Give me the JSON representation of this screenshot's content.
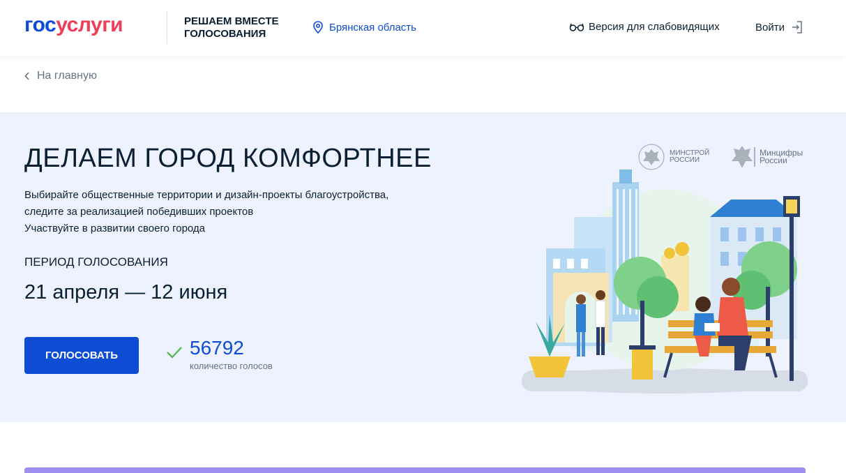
{
  "header": {
    "logo_part1": "гос",
    "logo_part2": "услуги",
    "project_title": "РЕШАЕМ ВМЕСТЕ ГОЛОСОВАНИЯ",
    "region": "Брянская область",
    "accessibility_label": "Версия для слабовидящих",
    "login_label": "Войти"
  },
  "breadcrumb": {
    "back_label": "На главную"
  },
  "hero": {
    "title": "ДЕЛАЕМ ГОРОД КОМФОРТНЕЕ",
    "description_line1": "Выбирайте общественные территории и дизайн-проекты благоустройства,",
    "description_line2": "следите за реализацией победивших проектов",
    "description_line3": "Участвуйте в развитии своего города",
    "period_label": "ПЕРИОД ГОЛОСОВАНИЯ",
    "period_value": "21 апреля — 12 июня",
    "vote_button": "ГОЛОСОВАТЬ",
    "votes_count": "56792",
    "votes_label": "количество голосов",
    "ministry1_line1": "МИНСТРОЙ",
    "ministry1_line2": "РОССИИ",
    "ministry2_line1": "Минцифры",
    "ministry2_line2": "России"
  },
  "colors": {
    "brand_blue": "#0d4cd3",
    "brand_red": "#ee3f58",
    "hero_bg": "#edf2fe",
    "check_green": "#5cb85c"
  }
}
